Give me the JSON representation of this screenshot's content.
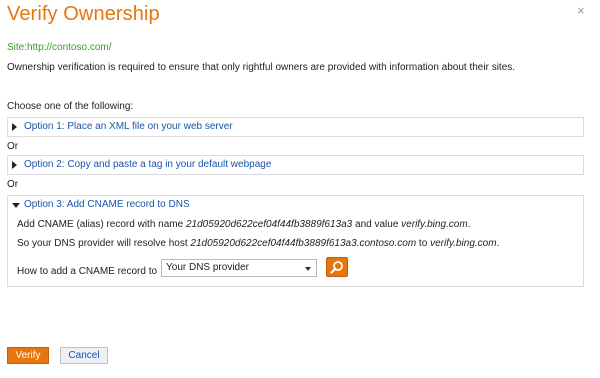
{
  "dialog": {
    "title": "Verify Ownership",
    "close_glyph": "×",
    "site_label": "Site:http://contoso.com/",
    "intro": "Ownership verification is required to ensure that only rightful owners are provided with information about their sites.",
    "choose": "Choose one of the following:",
    "or_label": "Or"
  },
  "options": [
    {
      "label": "Option 1: Place an XML file on your web server",
      "expanded": false
    },
    {
      "label": "Option 2: Copy and paste a tag in your default webpage",
      "expanded": false
    },
    {
      "label": "Option 3: Add CNAME record to DNS",
      "expanded": true
    }
  ],
  "cname": {
    "line1_prefix": "Add CNAME (alias) record with name ",
    "line1_name": "21d05920d622cef04f44fb3889f613a3",
    "line1_mid": " and value ",
    "line1_value": "verify.bing.com",
    "line1_suffix": ".",
    "line2_prefix": "So your DNS provider will resolve host ",
    "line2_host": "21d05920d622cef04f44fb3889f613a3.contoso.com",
    "line2_mid": " to ",
    "line2_value": "verify.bing.com",
    "line2_suffix": ".",
    "howto_label": "How to add a CNAME record to",
    "provider_selected": "Your DNS provider",
    "go_icon": "search-icon"
  },
  "buttons": {
    "verify": "Verify",
    "cancel": "Cancel"
  },
  "colors": {
    "accent": "#e8740c",
    "link": "#1a55a8",
    "site": "#3a9a2a"
  }
}
